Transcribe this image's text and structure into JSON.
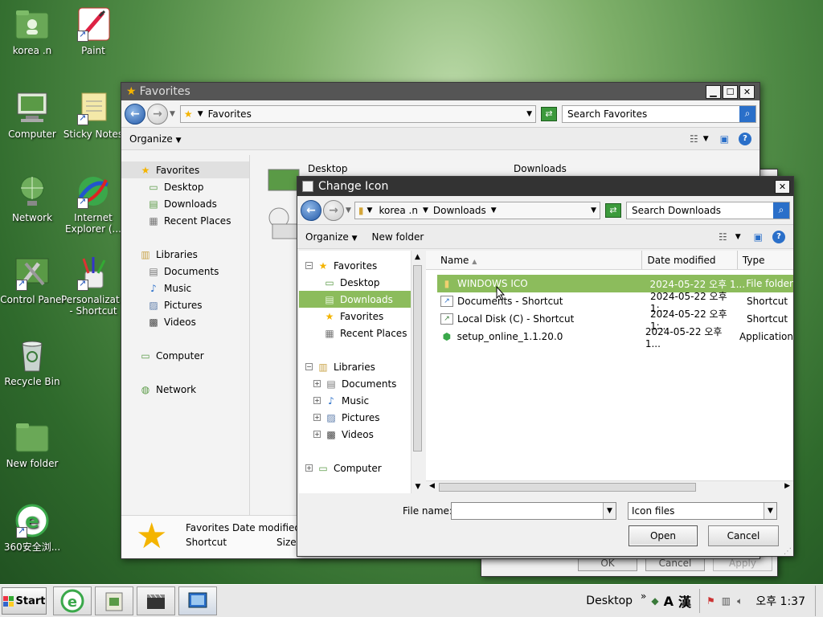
{
  "desktop": {
    "icons": [
      {
        "label": "korea .n"
      },
      {
        "label": "Paint"
      },
      {
        "label": "Computer"
      },
      {
        "label": "Sticky Notes"
      },
      {
        "label": "Network"
      },
      {
        "label": "Internet Explorer (..."
      },
      {
        "label": "Control Panel"
      },
      {
        "label": "Personalizat... - Shortcut"
      },
      {
        "label": "Recycle Bin"
      },
      {
        "label": "New folder"
      },
      {
        "label": "360安全浏..."
      }
    ]
  },
  "favorites_window": {
    "title": "Favorites",
    "address": "Favorites",
    "search_placeholder": "Search Favorites",
    "organize": "Organize",
    "nav": {
      "favorites": "Favorites",
      "desktop": "Desktop",
      "downloads": "Downloads",
      "recent_places": "Recent Places",
      "libraries": "Libraries",
      "documents": "Documents",
      "music": "Music",
      "pictures": "Pictures",
      "videos": "Videos",
      "computer": "Computer",
      "network": "Network"
    },
    "items": {
      "desktop": "Desktop",
      "downloads": "Downloads"
    },
    "details": {
      "name": "Favorites",
      "type": "Shortcut",
      "date_label": "Date modified:",
      "size_label": "Size:"
    },
    "behind_buttons": {
      "ok": "OK",
      "cancel": "Cancel",
      "apply": "Apply"
    }
  },
  "dialog": {
    "title": "Change Icon",
    "crumbs": [
      "korea .n",
      "Downloads"
    ],
    "search_placeholder": "Search Downloads",
    "organize": "Organize",
    "new_folder": "New folder",
    "nav": {
      "favorites": "Favorites",
      "desktop": "Desktop",
      "downloads": "Downloads",
      "favorites2": "Favorites",
      "recent_places": "Recent Places",
      "libraries": "Libraries",
      "documents": "Documents",
      "music": "Music",
      "pictures": "Pictures",
      "videos": "Videos",
      "computer": "Computer"
    },
    "columns": {
      "name": "Name",
      "date": "Date modified",
      "type": "Type"
    },
    "files": [
      {
        "name": "WINDOWS ICO",
        "date": "2024-05-22 오후 1...",
        "type": "File folder"
      },
      {
        "name": "Documents - Shortcut",
        "date": "2024-05-22 오후 1:...",
        "type": "Shortcut"
      },
      {
        "name": "Local Disk (C) - Shortcut",
        "date": "2024-05-22 오후 1:...",
        "type": "Shortcut"
      },
      {
        "name": "setup_online_1.1.20.0",
        "date": "2024-05-22 오후 1...",
        "type": "Application"
      }
    ],
    "filename_label": "File name:",
    "filename_value": "",
    "filter": "Icon files",
    "open": "Open",
    "cancel": "Cancel"
  },
  "taskbar": {
    "start": "Start",
    "desktop_label": "Desktop",
    "ime_a": "A",
    "ime_han": "漢",
    "clock": "오후 1:37"
  },
  "colors": {
    "selection": "#8cbc5c",
    "titlebar": "#333333",
    "accent": "#2a6fc9"
  }
}
